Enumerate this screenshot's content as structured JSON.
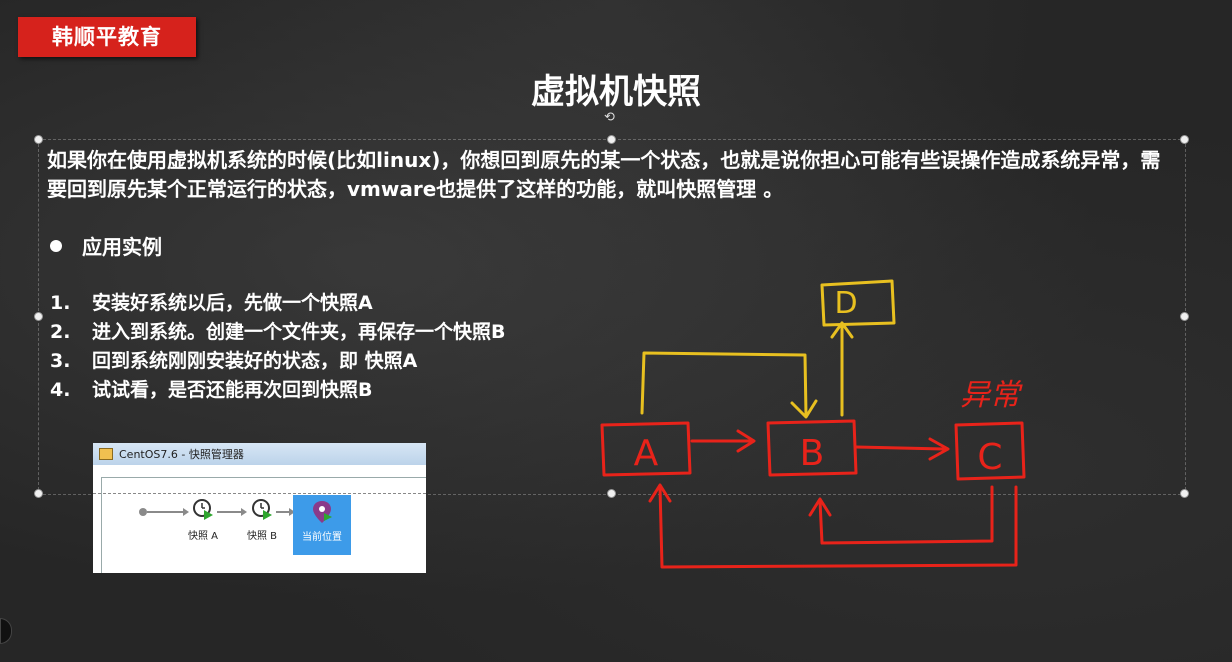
{
  "brand": {
    "label": "韩顺平教育",
    "color": "#d6221c"
  },
  "slide": {
    "title": "虚拟机快照",
    "intro": "如果你在使用虚拟机系统的时候(比如linux)，你想回到原先的某一个状态，也就是说你担心可能有些误操作造成系统异常，需要回到原先某个正常运行的状态，vmware也提供了这样的功能，就叫快照管理 。",
    "section_heading": "应用实例",
    "steps": [
      {
        "num": "1.",
        "text": "安装好系统以后，先做一个快照A"
      },
      {
        "num": "2.",
        "text": "进入到系统。创建一个文件夹，再保存一个快照B"
      },
      {
        "num": "3.",
        "text": "回到系统刚刚安装好的状态，即 快照A"
      },
      {
        "num": "4.",
        "text": "试试看，是否还能再次回到快照B"
      }
    ]
  },
  "snapshot_window": {
    "title": "CentOS7.6 - 快照管理器",
    "nodes": [
      {
        "label": "快照 A",
        "icon": "clock-snapshot-icon"
      },
      {
        "label": "快照 B",
        "icon": "clock-snapshot-icon"
      }
    ],
    "current": {
      "label": "当前位置",
      "icon": "location-pin-icon"
    },
    "accent": "#3d9be9"
  },
  "diagram": {
    "nodes": {
      "a": "A",
      "b": "B",
      "c": "C",
      "d": "D"
    },
    "annotation": "异常",
    "colors": {
      "red": "#e8231a",
      "yellow": "#e8c020"
    }
  }
}
